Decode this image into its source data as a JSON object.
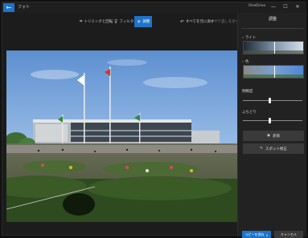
{
  "titlebar": {
    "back_icon": "←",
    "app_title": "フォト",
    "panel_app_name": "OneDrive",
    "minimize_icon": "—",
    "maximize_icon": "☐",
    "close_icon": "✕"
  },
  "toolbar": {
    "crop_icon": "⌗",
    "crop_label": "トリミングと回転",
    "filter_icon": "⊽",
    "filter_label": "フィルター",
    "adjust_icon": "☀",
    "adjust_label": "調整",
    "undo_icon": "↶",
    "undo_label": "すべてを元に戻す",
    "redo_icon": "↷",
    "redo_label": "やり直しを戻す"
  },
  "panel": {
    "header": "調整",
    "light_label": "ライト",
    "color_label": "色",
    "clarity_label": "明瞭度",
    "vignette_label": "ふちどり",
    "redeye_icon": "◉",
    "redeye_label": "赤目",
    "spot_fix_icon": "✎",
    "spot_fix_label": "スポット修正"
  },
  "values": {
    "light_handle": 0.5,
    "color_handle": 0.5,
    "clarity": 0.45,
    "vignette": 0.45
  },
  "footer": {
    "save_label": "コピーを保存",
    "save_dropdown_icon": "∨",
    "cancel_label": "キャンセル"
  },
  "colors": {
    "accent": "#1f73c8"
  }
}
